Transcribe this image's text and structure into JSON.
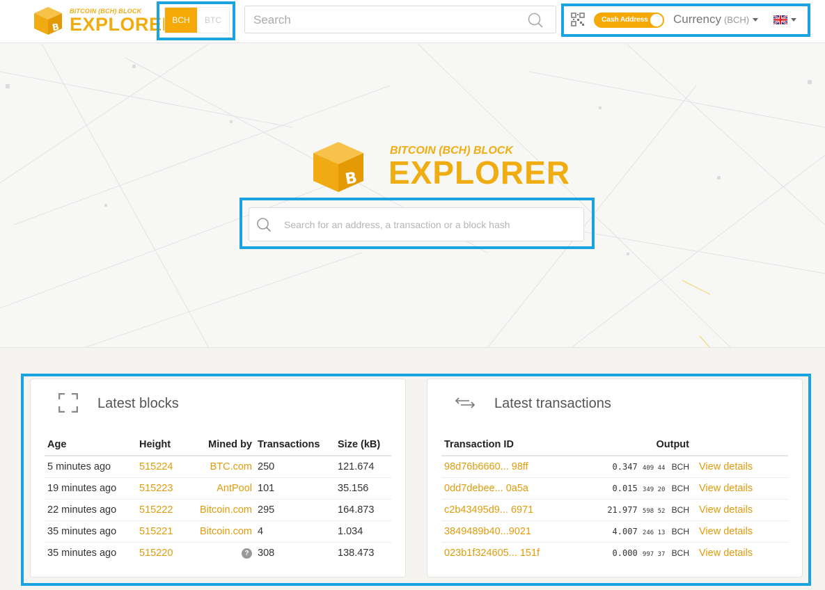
{
  "header": {
    "logo_sub": "BITCOIN (BCH) BLOCK",
    "logo_main": "EXPLORER",
    "coin_options": [
      "BCH",
      "BTC"
    ],
    "coin_selected": "BCH",
    "search_placeholder": "Search",
    "cash_address_label": "Cash Address",
    "currency_label": "Currency",
    "currency_code": "(BCH)",
    "language_icon": "uk-flag-icon"
  },
  "hero": {
    "logo_sub": "BITCOIN (BCH) BLOCK",
    "logo_main": "EXPLORER",
    "search_placeholder": "Search for an address, a transaction or a block hash"
  },
  "latest_blocks": {
    "title": "Latest blocks",
    "columns": [
      "Age",
      "Height",
      "Mined by",
      "Transactions",
      "Size (kB)"
    ],
    "rows": [
      {
        "age": "5 minutes ago",
        "height": "515224",
        "miner": "BTC.com",
        "transactions": "250",
        "size": "121.674"
      },
      {
        "age": "19 minutes ago",
        "height": "515223",
        "miner": "AntPool",
        "transactions": "101",
        "size": "35.156"
      },
      {
        "age": "22 minutes ago",
        "height": "515222",
        "miner": "Bitcoin.com",
        "transactions": "295",
        "size": "164.873"
      },
      {
        "age": "35 minutes ago",
        "height": "515221",
        "miner": "Bitcoin.com",
        "transactions": "4",
        "size": "1.034"
      },
      {
        "age": "35 minutes ago",
        "height": "515220",
        "miner": "?",
        "transactions": "308",
        "size": "138.473"
      }
    ]
  },
  "latest_transactions": {
    "title": "Latest transactions",
    "columns": [
      "Transaction ID",
      "Output"
    ],
    "view_label": "View details",
    "unit": "BCH",
    "rows": [
      {
        "txid": "98d76b6660... 98ff",
        "amount_main": "0.347",
        "amount_small": "409 44"
      },
      {
        "txid": "0dd7debee... 0a5a",
        "amount_main": "0.015",
        "amount_small": "349 20"
      },
      {
        "txid": "c2b43495d9... 6971",
        "amount_main": "21.977",
        "amount_small": "598 52"
      },
      {
        "txid": "3849489b40...9021",
        "amount_main": "4.007",
        "amount_small": "246 13"
      },
      {
        "txid": "023b1f324605... 151f",
        "amount_main": "0.000",
        "amount_small": "997 37"
      }
    ]
  },
  "colors": {
    "accent": "#f4a906",
    "link": "#e09b0c",
    "highlight": "#1aa3e0"
  }
}
